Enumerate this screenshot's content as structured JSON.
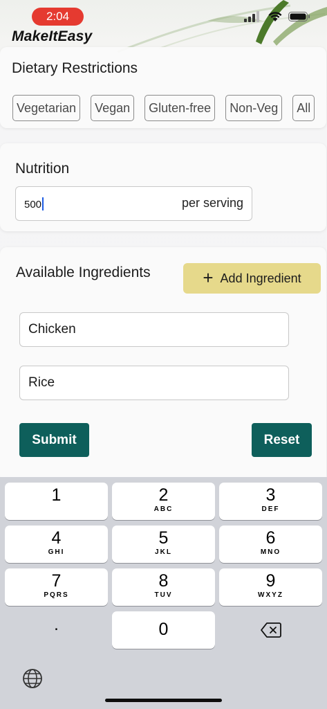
{
  "status_bar": {
    "time": "2:04"
  },
  "app": {
    "title": "MakeItEasy"
  },
  "dietary": {
    "title": "Dietary Restrictions",
    "options": [
      "Vegetarian",
      "Vegan",
      "Gluten-free",
      "Non-Veg",
      "All"
    ]
  },
  "nutrition": {
    "title": "Nutrition",
    "value": "500",
    "unit": "per serving"
  },
  "ingredients": {
    "title": "Available Ingredients",
    "add_label": "Add Ingredient",
    "items": [
      "Chicken",
      "Rice"
    ],
    "submit_label": "Submit",
    "reset_label": "Reset"
  },
  "keyboard": {
    "keys": [
      {
        "num": "1",
        "letters": ""
      },
      {
        "num": "2",
        "letters": "ABC"
      },
      {
        "num": "3",
        "letters": "DEF"
      },
      {
        "num": "4",
        "letters": "GHI"
      },
      {
        "num": "5",
        "letters": "JKL"
      },
      {
        "num": "6",
        "letters": "MNO"
      },
      {
        "num": "7",
        "letters": "PQRS"
      },
      {
        "num": "8",
        "letters": "TUV"
      },
      {
        "num": "9",
        "letters": "WXYZ"
      },
      {
        "num": "0",
        "letters": ""
      }
    ],
    "dot": "."
  },
  "colors": {
    "accent_teal": "#0e5f5b",
    "add_button": "#e6d98b",
    "time_pill": "#e53a30"
  }
}
